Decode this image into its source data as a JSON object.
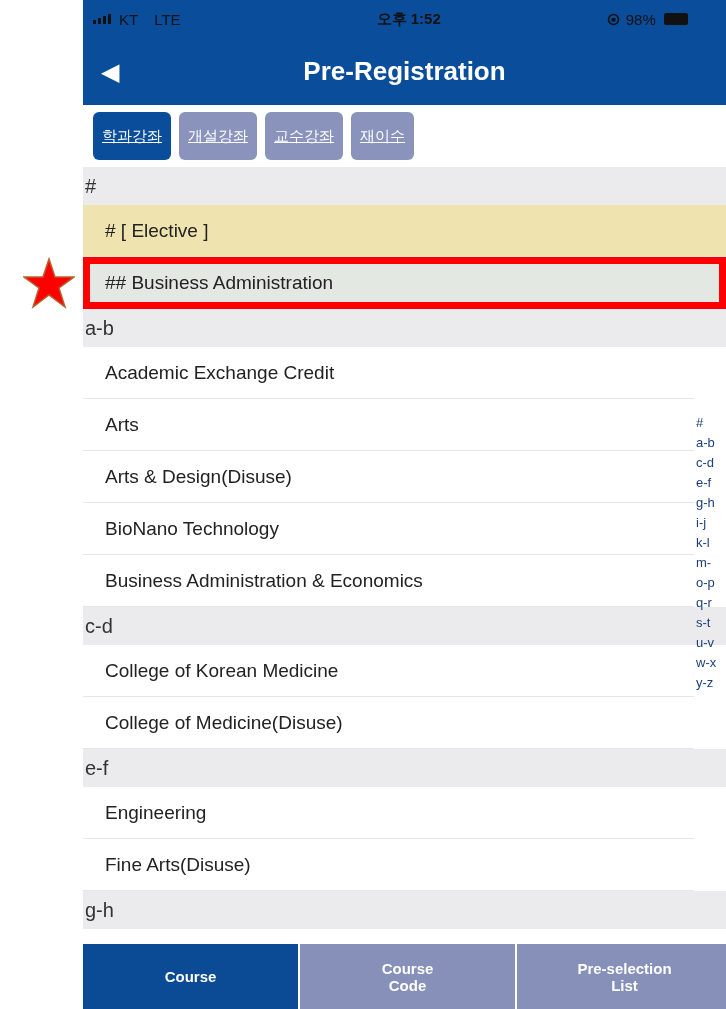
{
  "status_bar": {
    "carrier": "KT",
    "network": "LTE",
    "time": "오후 1:52",
    "battery": "98%"
  },
  "header": {
    "back": "◀",
    "title": "Pre-Registration"
  },
  "tabs": [
    {
      "label": "학과강좌",
      "selected": true
    },
    {
      "label": "개설강좌",
      "selected": false
    },
    {
      "label": "교수강좌",
      "selected": false
    },
    {
      "label": "재이수",
      "selected": false
    }
  ],
  "sections": [
    {
      "label": "#",
      "items": [
        {
          "label": "# [ Elective ]",
          "kind": "elective",
          "marked": false
        },
        {
          "label": "## Business Administration",
          "kind": "major",
          "marked": true
        }
      ]
    },
    {
      "label": "a-b",
      "items": [
        {
          "label": "Academic Exchange Credit",
          "kind": "plain",
          "marked": false
        },
        {
          "label": "Arts",
          "kind": "plain",
          "marked": false
        },
        {
          "label": "Arts & Design(Disuse)",
          "kind": "plain",
          "marked": false
        },
        {
          "label": "BioNano Technology",
          "kind": "plain",
          "marked": false
        },
        {
          "label": "Business Administration & Economics",
          "kind": "plain",
          "marked": false
        }
      ]
    },
    {
      "label": "c-d",
      "items": [
        {
          "label": "College of Korean Medicine",
          "kind": "plain",
          "marked": false
        },
        {
          "label": "College of Medicine(Disuse)",
          "kind": "plain",
          "marked": false
        }
      ]
    },
    {
      "label": "e-f",
      "items": [
        {
          "label": "Engineering",
          "kind": "plain",
          "marked": false
        },
        {
          "label": "Fine Arts(Disuse)",
          "kind": "plain",
          "marked": false
        }
      ]
    },
    {
      "label": "g-h"
    }
  ],
  "index": [
    "#",
    "a-b",
    "c-d",
    "e-f",
    "g-h",
    "i-j",
    "k-l",
    "m-",
    "o-p",
    "q-r",
    "s-t",
    "u-v",
    "w-x",
    "y-z"
  ],
  "bottom_tabs": [
    {
      "label": "Course",
      "selected": true
    },
    {
      "label": "Course\nCode",
      "selected": false
    },
    {
      "label": "Pre-selection\nList",
      "selected": false
    }
  ]
}
